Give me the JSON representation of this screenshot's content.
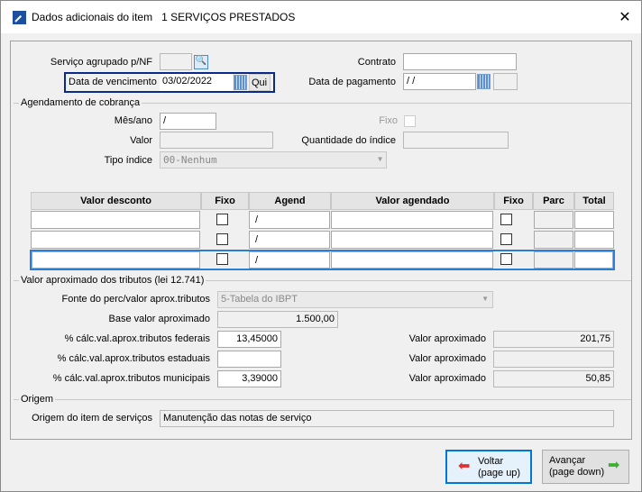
{
  "window": {
    "title": "Dados adicionais do item",
    "subtitle": "1 SERVIÇOS PRESTADOS",
    "close": "✕"
  },
  "fields": {
    "servico_agrupado": {
      "label": "Serviço agrupado p/NF",
      "value": ""
    },
    "data_vencimento": {
      "label": "Data de vencimento",
      "value": "03/02/2022",
      "weekday": "Qui"
    },
    "contrato": {
      "label": "Contrato",
      "value": ""
    },
    "data_pagamento": {
      "label": "Data de pagamento",
      "value": " / /"
    }
  },
  "agendamento": {
    "title": "Agendamento de cobrança",
    "mes_ano": {
      "label": "Mês/ano",
      "value": " /"
    },
    "fixo": {
      "label": "Fixo",
      "checked": false
    },
    "valor": {
      "label": "Valor",
      "value": ""
    },
    "quantidade": {
      "label": "Quantidade do índice",
      "value": ""
    },
    "tipo_indice": {
      "label": "Tipo índice",
      "value": "00-Nenhum"
    }
  },
  "table": {
    "headers": [
      "Valor desconto",
      "Fixo",
      "Agend",
      "Valor agendado",
      "Fixo",
      "Parc",
      "Total"
    ],
    "rows": [
      {
        "agend": "/"
      },
      {
        "agend": "/"
      },
      {
        "agend": "/"
      }
    ]
  },
  "tributos": {
    "title": "Valor aproximado dos tributos (lei 12.741)",
    "fonte": {
      "label": "Fonte do perc/valor aprox.tributos",
      "value": "5-Tabela do IBPT"
    },
    "base": {
      "label": "Base valor aproximado",
      "value": "1.500,00"
    },
    "federais": {
      "label": "% cálc.val.aprox.tributos federais",
      "value": "13,45000",
      "aprox_label": "Valor aproximado",
      "aprox": "201,75"
    },
    "estaduais": {
      "label": "% cálc.val.aprox.tributos estaduais",
      "value": "",
      "aprox_label": "Valor aproximado",
      "aprox": ""
    },
    "municipais": {
      "label": "% cálc.val.aprox.tributos municipais",
      "value": "3,39000",
      "aprox_label": "Valor aproximado",
      "aprox": "50,85"
    }
  },
  "origem": {
    "title": "Origem",
    "label": "Origem do item de serviços",
    "value": "Manutenção das notas de serviço"
  },
  "buttons": {
    "voltar": {
      "label": "Voltar",
      "hint": "(page up)"
    },
    "avancar": {
      "label": "Avançar",
      "hint": "(page down)"
    }
  }
}
